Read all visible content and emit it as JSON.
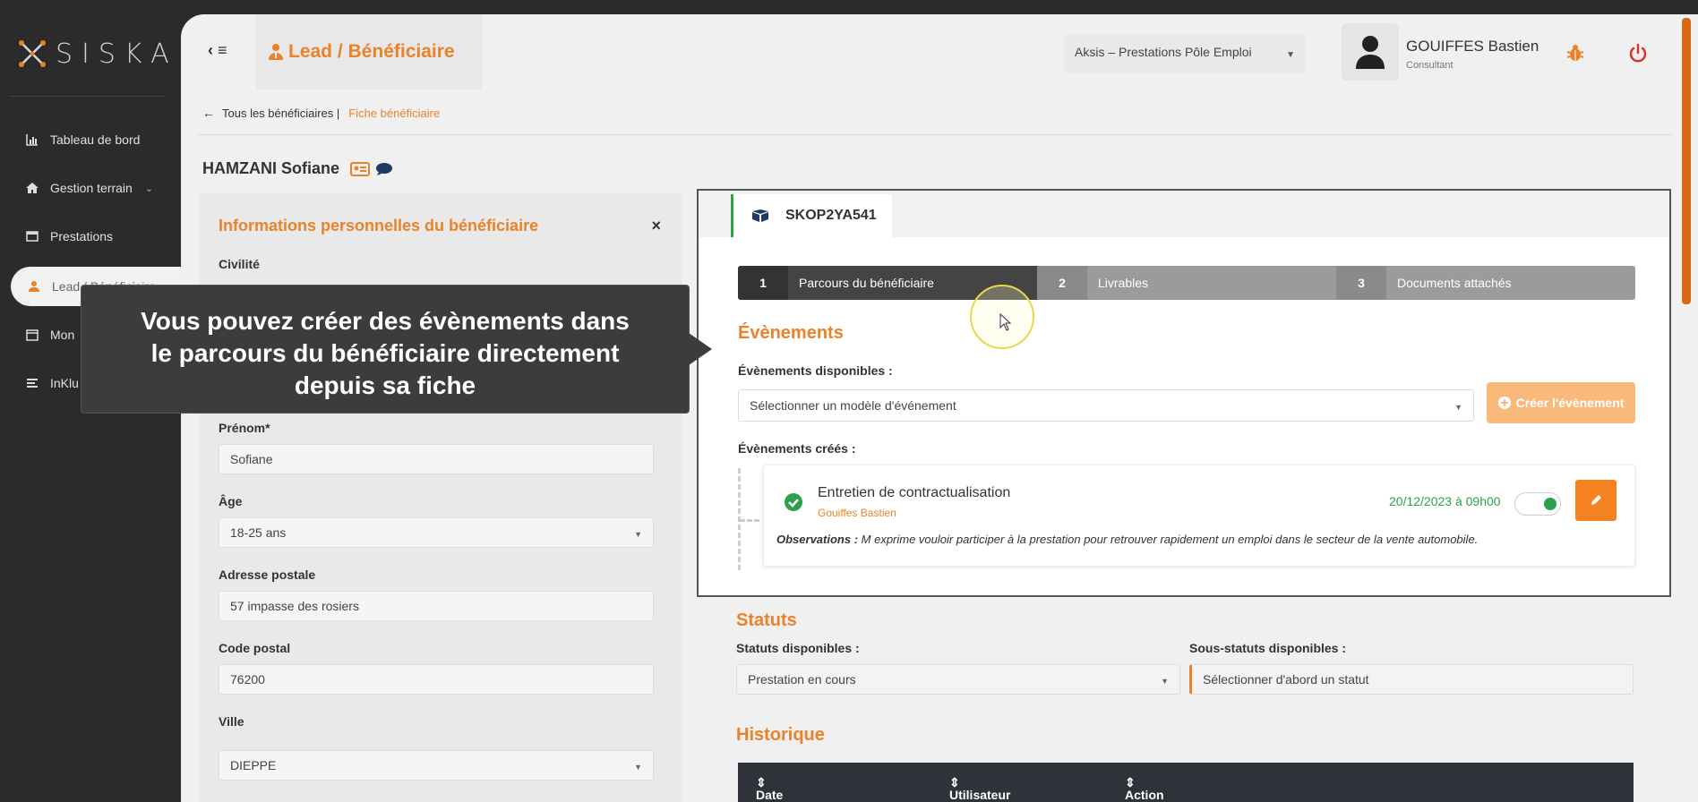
{
  "sidebar": {
    "brand": "SISKA",
    "items": [
      {
        "label": "Tableau de bord",
        "icon": "bar-chart-icon"
      },
      {
        "label": "Gestion terrain",
        "icon": "home-icon"
      },
      {
        "label": "Prestations",
        "icon": "window-icon"
      },
      {
        "label": "Lead / Bénéficiaire",
        "icon": "user-icon"
      },
      {
        "label": "Mon",
        "icon": "calendar-icon"
      },
      {
        "label": "InKlu",
        "icon": "list-icon"
      }
    ]
  },
  "header": {
    "title": "Lead / Bénéficiaire",
    "organization": "Aksis – Prestations Pôle Emploi",
    "user_name": "GOUIFFES Bastien",
    "user_role": "Consultant"
  },
  "breadcrumb": {
    "parent": "Tous les bénéficiaires |",
    "current": "Fiche bénéficiaire"
  },
  "person": {
    "name": "HAMZANI Sofiane"
  },
  "left_panel": {
    "title": "Informations personnelles du bénéficiaire",
    "close": "×",
    "civilite_label": "Civilité",
    "prenom_label": "Prénom*",
    "prenom_value": "Sofiane",
    "age_label": "Âge",
    "age_value": "18-25 ans",
    "adresse_label": "Adresse postale",
    "adresse_value": "57 impasse des rosiers",
    "cp_label": "Code postal",
    "cp_value": "76200",
    "ville_label": "Ville",
    "ville_value": "DIEPPE"
  },
  "card": {
    "tab_label": "SKOP2YA541",
    "steps": [
      {
        "num": "1",
        "label": "Parcours du bénéficiaire"
      },
      {
        "num": "2",
        "label": "Livrables"
      },
      {
        "num": "3",
        "label": "Documents attachés"
      }
    ],
    "events_title": "Évènements",
    "available_label": "Évènements disponibles :",
    "select_placeholder": "Sélectionner un modèle d'événement",
    "create_button": "Créer l'évènement",
    "created_label": "Évènements créés :",
    "event": {
      "name": "Entretien de contractualisation",
      "user": "Gouiffes Bastien",
      "date": "20/12/2023 à 09h00",
      "obs_label": "Observations :",
      "obs_text": " M exprime vouloir participer à la prestation pour retrouver rapidement un emploi dans le secteur de la vente automobile."
    }
  },
  "statuts": {
    "title": "Statuts",
    "available_label": "Statuts disponibles :",
    "selected": "Prestation en cours",
    "sub_label": "Sous-statuts disponibles :",
    "sub_placeholder": "Sélectionner d'abord un statut"
  },
  "historique": {
    "title": "Historique",
    "columns": [
      "Date",
      "Utilisateur",
      "Action"
    ]
  },
  "tooltip": {
    "line1": "Vous pouvez créer des évènements dans",
    "line2": "le parcours du bénéficiaire directement",
    "line3": "depuis sa fiche"
  },
  "colors": {
    "accent": "#e8832a",
    "success": "#2e9f4a",
    "dark": "#2b2b2b"
  }
}
